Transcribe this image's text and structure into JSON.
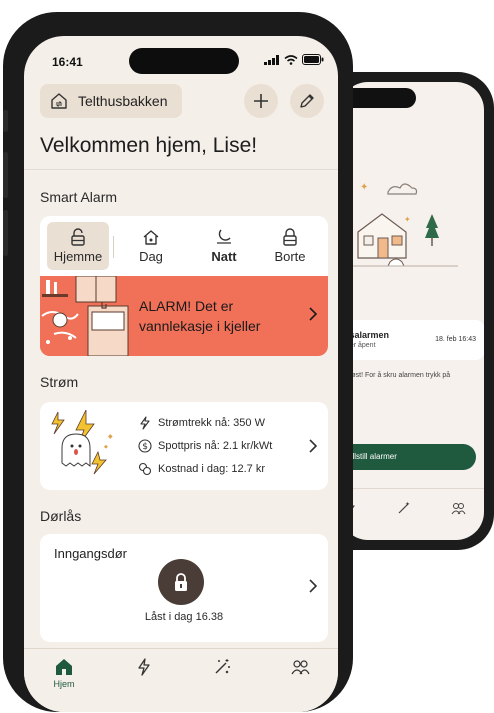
{
  "status_bar": {
    "time": "16:41"
  },
  "header": {
    "home_name": "Telthusbakken",
    "welcome": "Velkommen hjem, Lise!"
  },
  "smart_alarm": {
    "title": "Smart Alarm",
    "modes": [
      {
        "label": "Hjemme",
        "active": true
      },
      {
        "label": "Dag",
        "active": false
      },
      {
        "label": "Natt",
        "active": false
      },
      {
        "label": "Borte",
        "active": false
      }
    ],
    "alert_line1": "ALARM! Det er",
    "alert_line2": "vannlekasje i kjeller",
    "alert_color": "#f07058"
  },
  "strom": {
    "title": "Strøm",
    "rows": [
      {
        "icon": "lightning-icon",
        "text": "Strømtrekk nå: 350 W"
      },
      {
        "icon": "dollar-icon",
        "text": "Spottpris nå: 2.1 kr/kWt"
      },
      {
        "icon": "coins-icon",
        "text": "Kostnad i dag: 12.7 kr"
      }
    ]
  },
  "dorlas": {
    "title": "Dørlås",
    "door_name": "Inngangsdør",
    "status": "Låst i dag 16.38"
  },
  "tabbar": {
    "tabs": [
      {
        "icon": "home-icon",
        "label": "Hjem",
        "active": true
      },
      {
        "icon": "lightning-icon",
        "label": "",
        "active": false
      },
      {
        "icon": "magic-wand-icon",
        "label": "",
        "active": false
      },
      {
        "icon": "users-icon",
        "label": "",
        "active": false
      }
    ]
  },
  "back_phone": {
    "card_title": "dsalarmen",
    "card_sub": "e er åpent",
    "card_date": "18. feb 16:43",
    "message": "utløst! For å skru alarmen trykk på",
    "button": "ullstill alarmer"
  },
  "colors": {
    "background": "#f4efe9",
    "chip": "#eadfd3",
    "accent_green": "#1f5a3e",
    "lock": "#4a3c36",
    "alarm": "#f07058"
  }
}
